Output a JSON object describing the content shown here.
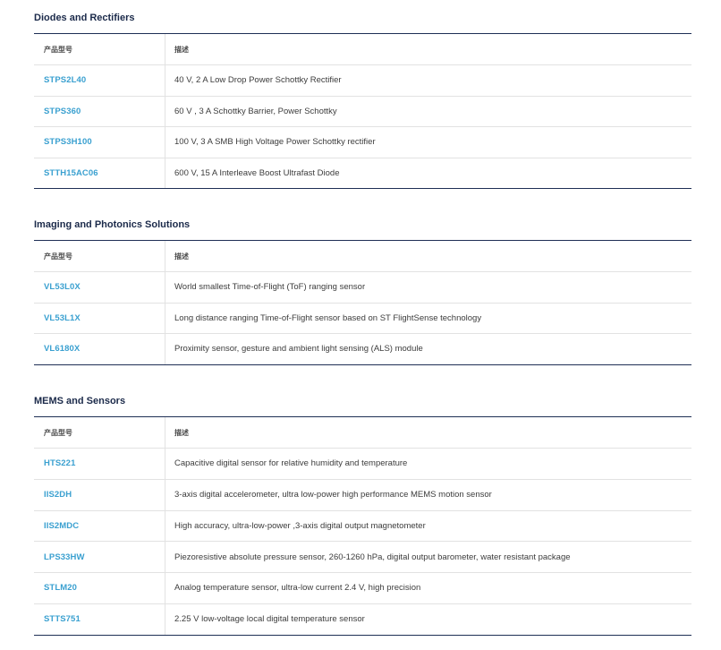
{
  "sections": [
    {
      "title": "Diodes and Rectifiers",
      "headers": {
        "part": "产品型号",
        "desc": "描述"
      },
      "rows": [
        {
          "part": "STPS2L40",
          "desc": "40 V, 2 A Low Drop Power Schottky Rectifier"
        },
        {
          "part": "STPS360",
          "desc": "60 V , 3 A Schottky Barrier, Power Schottky"
        },
        {
          "part": "STPS3H100",
          "desc": "100 V, 3 A SMB High Voltage Power Schottky rectifier"
        },
        {
          "part": "STTH15AC06",
          "desc": "600 V, 15 A Interleave Boost Ultrafast Diode"
        }
      ]
    },
    {
      "title": "Imaging and Photonics Solutions",
      "headers": {
        "part": "产品型号",
        "desc": "描述"
      },
      "rows": [
        {
          "part": "VL53L0X",
          "desc": "World smallest Time-of-Flight (ToF) ranging sensor"
        },
        {
          "part": "VL53L1X",
          "desc": "Long distance ranging Time-of-Flight sensor based on ST FlightSense technology"
        },
        {
          "part": "VL6180X",
          "desc": "Proximity sensor, gesture and ambient light sensing (ALS) module"
        }
      ]
    },
    {
      "title": "MEMS and Sensors",
      "headers": {
        "part": "产品型号",
        "desc": "描述"
      },
      "rows": [
        {
          "part": "HTS221",
          "desc": "Capacitive digital sensor for relative humidity and temperature"
        },
        {
          "part": "IIS2DH",
          "desc": "3-axis digital accelerometer, ultra low-power high performance MEMS motion sensor"
        },
        {
          "part": "IIS2MDC",
          "desc": "High accuracy, ultra-low-power ,3-axis digital output magnetometer"
        },
        {
          "part": "LPS33HW",
          "desc": "Piezoresistive absolute pressure sensor, 260-1260 hPa, digital output barometer, water resistant package"
        },
        {
          "part": "STLM20",
          "desc": "Analog temperature sensor, ultra-low current 2.4 V, high precision"
        },
        {
          "part": "STTS751",
          "desc": "2.25 V low-voltage local digital temperature sensor"
        }
      ]
    }
  ],
  "colors": {
    "title": "#1b2a4a",
    "link": "#3aa0d0",
    "rule_dark": "#1e2f55",
    "rule_light": "#e2e2e2"
  }
}
